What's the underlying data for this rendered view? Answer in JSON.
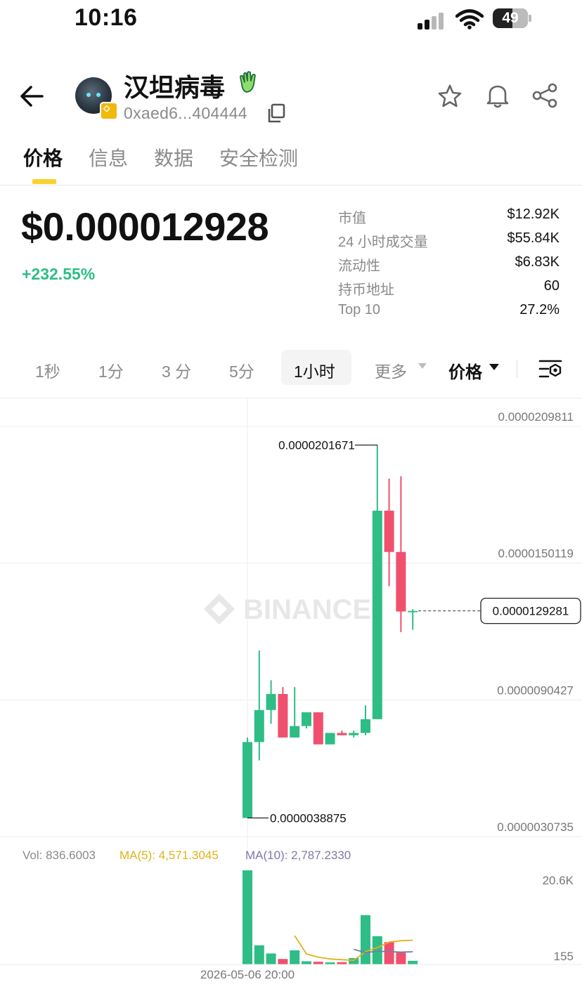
{
  "status_bar": {
    "time": "10:16",
    "battery": "49"
  },
  "header": {
    "token_name": "汉坦病毒",
    "address": "0xaed6...404444"
  },
  "tabs": [
    {
      "label": "价格",
      "active": true
    },
    {
      "label": "信息",
      "active": false
    },
    {
      "label": "数据",
      "active": false
    },
    {
      "label": "安全检测",
      "active": false
    }
  ],
  "price": {
    "value": "$0.000012928",
    "change": "+232.55%"
  },
  "stats": [
    {
      "label": "市值",
      "value": "$12.92K"
    },
    {
      "label": "24 小时成交量",
      "value": "$55.84K"
    },
    {
      "label": "流动性",
      "value": "$6.83K"
    },
    {
      "label": "持币地址",
      "value": "60"
    },
    {
      "label": "Top 10",
      "value": "27.2%"
    }
  ],
  "intervals": [
    {
      "label": "1秒",
      "active": false
    },
    {
      "label": "1分",
      "active": false
    },
    {
      "label": "3 分",
      "active": false
    },
    {
      "label": "5分",
      "active": false
    },
    {
      "label": "1小时",
      "active": true
    },
    {
      "label": "更多",
      "active": false
    }
  ],
  "price_type": "价格",
  "chart": {
    "watermark": "BINANCE",
    "y_axis_labels": [
      "0.0000209811",
      "0.0000150119",
      "0.0000090427",
      "0.0000030735"
    ],
    "high_label": "0.0000201671",
    "low_label": "0.0000038875",
    "current_label": "0.0000129281",
    "x_label": "2026-05-06 20:00",
    "volume_axis_labels": [
      "20.6K",
      "155"
    ]
  },
  "volume_legend": {
    "vol": "Vol: 836.6003",
    "ma5": "MA(5): 4,571.3045",
    "ma10": "MA(10): 2,787.2330"
  },
  "colors": {
    "up": "#2ebd85",
    "down": "#f0506e",
    "accent": "#f7d230",
    "ma5": "#e0b21a",
    "ma10": "#7e7aa8"
  },
  "chart_data": {
    "type": "candlestick",
    "y_ticks": [
      2.09811e-05,
      1.50119e-05,
      9.0427e-06,
      3.0735e-06
    ],
    "ylim": [
      3.0735e-06,
      2.09811e-05
    ],
    "last_price": 1.29281e-05,
    "candles": [
      {
        "open": 3.8875e-06,
        "high": 7.4e-06,
        "low": 3.8875e-06,
        "close": 7.2e-06
      },
      {
        "open": 7.2e-06,
        "high": 1.12e-05,
        "low": 6.4e-06,
        "close": 8.6e-06
      },
      {
        "open": 8.6e-06,
        "high": 9.9e-06,
        "low": 8e-06,
        "close": 9.3e-06
      },
      {
        "open": 9.3e-06,
        "high": 9.6e-06,
        "low": 7.4e-06,
        "close": 7.4e-06
      },
      {
        "open": 7.4e-06,
        "high": 9.6e-06,
        "low": 7.4e-06,
        "close": 7.9e-06
      },
      {
        "open": 7.9e-06,
        "high": 8.5e-06,
        "low": 7.8e-06,
        "close": 8.5e-06
      },
      {
        "open": 8.5e-06,
        "high": 8.5e-06,
        "low": 7.1e-06,
        "close": 7.1e-06
      },
      {
        "open": 7.1e-06,
        "high": 7.6e-06,
        "low": 7.1e-06,
        "close": 7.6e-06
      },
      {
        "open": 7.6e-06,
        "high": 7.7e-06,
        "low": 7.5e-06,
        "close": 7.5e-06
      },
      {
        "open": 7.5e-06,
        "high": 7.7e-06,
        "low": 7.4e-06,
        "close": 7.6e-06
      },
      {
        "open": 7.6e-06,
        "high": 8.8e-06,
        "low": 7.5e-06,
        "close": 8.2e-06
      },
      {
        "open": 8.2e-06,
        "high": 2.01671e-05,
        "low": 8.2e-06,
        "close": 1.73e-05
      },
      {
        "open": 1.73e-05,
        "high": 1.87e-05,
        "low": 1.4e-05,
        "close": 1.55e-05
      },
      {
        "open": 1.55e-05,
        "high": 1.88e-05,
        "low": 1.2e-05,
        "close": 1.29e-05
      },
      {
        "open": 1.29e-05,
        "high": 1.3e-05,
        "low": 1.21e-05,
        "close": 1.29281e-05
      }
    ],
    "volume": {
      "ylim": [
        155,
        20600
      ],
      "values": [
        20600,
        4200,
        2400,
        1200,
        3100,
        700,
        600,
        450,
        500,
        1400,
        10800,
        6200,
        4900,
        2600,
        800
      ],
      "ma5": [
        null,
        null,
        null,
        null,
        6300,
        2300,
        1600,
        1200,
        1050,
        900,
        2800,
        3700,
        4900,
        5200,
        5300
      ],
      "ma10": [
        null,
        null,
        null,
        null,
        null,
        null,
        null,
        null,
        null,
        3300,
        2600,
        2900,
        2800,
        2700,
        2787
      ]
    }
  }
}
